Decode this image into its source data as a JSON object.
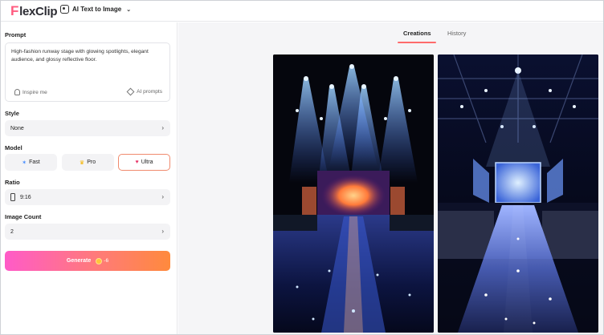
{
  "app": {
    "logo_text": "lexClip",
    "logo_letter": "F",
    "tool_name": "AI Text to Image"
  },
  "sidebar": {
    "prompt_label": "Prompt",
    "prompt_text": "High-fashion runway stage with glowing spotlights, elegant audience, and glossy reflective floor.",
    "inspire_label": "Inspire me",
    "ai_prompts_label": "AI prompts",
    "style_label": "Style",
    "style_value": "None",
    "model_label": "Model",
    "models": [
      {
        "label": "Fast",
        "icon": "fast-icon"
      },
      {
        "label": "Pro",
        "icon": "crown-icon"
      },
      {
        "label": "Ultra",
        "icon": "heart-icon"
      }
    ],
    "selected_model": "Ultra",
    "ratio_label": "Ratio",
    "ratio_value": "9:16",
    "count_label": "Image Count",
    "count_value": "2",
    "generate_label": "Generate",
    "generate_cost": "-6"
  },
  "main": {
    "tabs": [
      {
        "label": "Creations",
        "active": true
      },
      {
        "label": "History",
        "active": false
      }
    ]
  },
  "colors": {
    "accent_gradient_start": "#ff5bc8",
    "accent_gradient_end": "#ff8a3d",
    "tab_underline": "#ff6b6b",
    "selected_model_border": "#f08a6d"
  }
}
